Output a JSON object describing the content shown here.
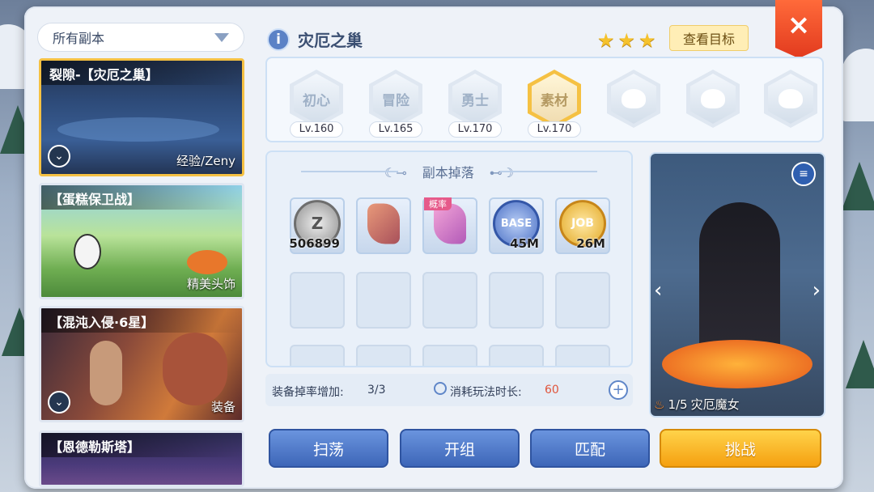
{
  "filter": {
    "label": "所有副本"
  },
  "dungeon_list": [
    {
      "title": "裂隙-【灾厄之巢】",
      "tag": "经验/Zeny",
      "selected": true
    },
    {
      "title": "【蛋糕保卫战】",
      "tag": "精美头饰",
      "selected": false
    },
    {
      "title": "【混沌入侵·6星】",
      "tag": "装备",
      "selected": false
    },
    {
      "title": "【恩德勒斯塔】",
      "tag": "",
      "selected": false
    }
  ],
  "header": {
    "title": "灾厄之巢",
    "stars": 3,
    "goal_button": "查看目标",
    "close_label": "×"
  },
  "difficulties": [
    {
      "name": "初心",
      "level": "Lv.160",
      "active": false
    },
    {
      "name": "冒险",
      "level": "Lv.165",
      "active": false
    },
    {
      "name": "勇士",
      "level": "Lv.170",
      "active": false
    },
    {
      "name": "素材",
      "level": "Lv.170",
      "active": true
    },
    {
      "name": "",
      "level": "",
      "locked": true
    },
    {
      "name": "",
      "level": "",
      "locked": true
    },
    {
      "name": "",
      "level": "",
      "locked": true
    }
  ],
  "drops": {
    "title": "副本掉落",
    "items": [
      {
        "icon": "zeny-coin-icon",
        "glyph": "Z",
        "qty": "506899"
      },
      {
        "icon": "rune-stone-icon",
        "glyph": "",
        "qty": ""
      },
      {
        "icon": "pink-rune-stone-icon",
        "glyph": "",
        "qty": "",
        "badge": "概率"
      },
      {
        "icon": "base-exp-icon",
        "glyph": "BASE",
        "qty": "45M"
      },
      {
        "icon": "job-exp-icon",
        "glyph": "JOB",
        "qty": "26M"
      }
    ]
  },
  "stats": {
    "drop_rate_label": "装备掉率增加:",
    "drop_rate_value": "3/3",
    "time_label": "消耗玩法时长:",
    "time_value": "60"
  },
  "boss": {
    "counter": "1/5",
    "name": "灾厄魔女"
  },
  "buttons": {
    "sweep": "扫荡",
    "team": "开组",
    "match": "匹配",
    "challenge": "挑战"
  },
  "colors": {
    "accent_gold": "#f5c143",
    "time_value": "#e0553c"
  }
}
